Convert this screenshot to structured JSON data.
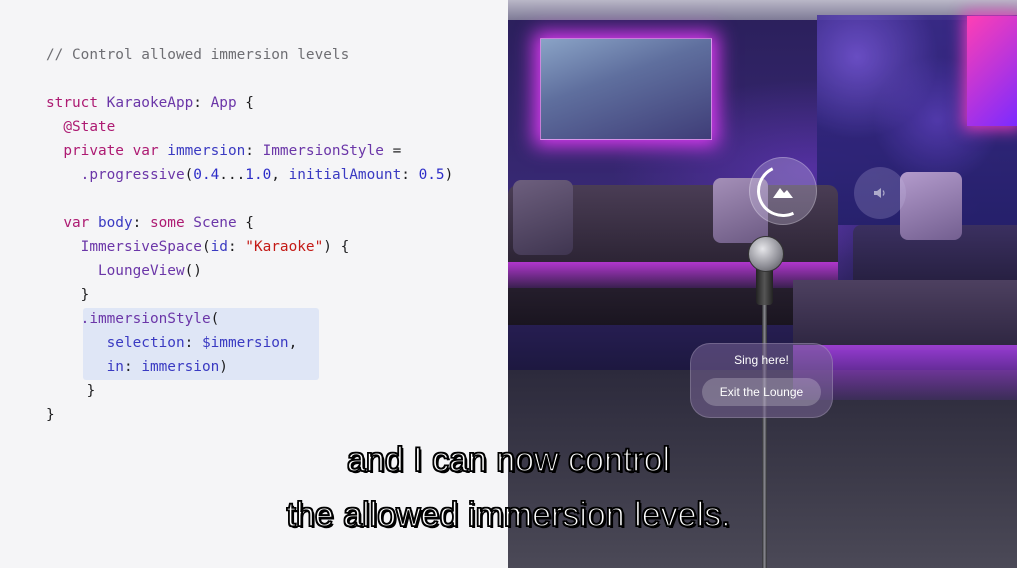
{
  "code": {
    "lines": [
      [
        {
          "t": "// Control allowed immersion levels",
          "c": "comment"
        }
      ],
      [
        {
          "t": "struct ",
          "c": "kw"
        },
        {
          "t": "KaraokeApp",
          "c": "type"
        },
        {
          "t": ": ",
          "c": "plain"
        },
        {
          "t": "App",
          "c": "type"
        },
        {
          "t": " {",
          "c": "plain"
        }
      ],
      [
        {
          "t": "  @State",
          "c": "kw"
        }
      ],
      [
        {
          "t": "  private var ",
          "c": "kw"
        },
        {
          "t": "immersion",
          "c": "prop"
        },
        {
          "t": ": ",
          "c": "plain"
        },
        {
          "t": "ImmersionStyle",
          "c": "type"
        },
        {
          "t": " =",
          "c": "plain"
        }
      ],
      [
        {
          "t": "    .progressive",
          "c": "type"
        },
        {
          "t": "(",
          "c": "plain"
        },
        {
          "t": "0.4",
          "c": "num"
        },
        {
          "t": "...",
          "c": "plain"
        },
        {
          "t": "1.0",
          "c": "num"
        },
        {
          "t": ", ",
          "c": "plain"
        },
        {
          "t": "initialAmount",
          "c": "prop"
        },
        {
          "t": ": ",
          "c": "plain"
        },
        {
          "t": "0.5",
          "c": "num"
        },
        {
          "t": ")",
          "c": "plain"
        }
      ],
      [
        {
          "t": "  var ",
          "c": "kw"
        },
        {
          "t": "body",
          "c": "prop"
        },
        {
          "t": ": ",
          "c": "plain"
        },
        {
          "t": "some ",
          "c": "kw"
        },
        {
          "t": "Scene",
          "c": "type"
        },
        {
          "t": " {",
          "c": "plain"
        }
      ],
      [
        {
          "t": "    ImmersiveSpace",
          "c": "type"
        },
        {
          "t": "(",
          "c": "plain"
        },
        {
          "t": "id",
          "c": "prop"
        },
        {
          "t": ": ",
          "c": "plain"
        },
        {
          "t": "\"Karaoke\"",
          "c": "str"
        },
        {
          "t": ") {",
          "c": "plain"
        }
      ],
      [
        {
          "t": "      LoungeView",
          "c": "type"
        },
        {
          "t": "()",
          "c": "plain"
        }
      ],
      [
        {
          "t": "    }",
          "c": "plain"
        }
      ],
      [
        {
          "t": "    .immersionStyle",
          "c": "type"
        },
        {
          "t": "(",
          "c": "plain"
        }
      ],
      [
        {
          "t": "       selection",
          "c": "prop"
        },
        {
          "t": ": ",
          "c": "plain"
        },
        {
          "t": "$immersion",
          "c": "prop"
        },
        {
          "t": ",",
          "c": "plain"
        }
      ],
      [
        {
          "t": "       in",
          "c": "prop"
        },
        {
          "t": ": ",
          "c": "plain"
        },
        {
          "t": "immersion",
          "c": "prop"
        },
        {
          "t": ")",
          "c": "plain"
        }
      ],
      [
        {
          "t": "    }",
          "c": "plain"
        }
      ],
      [
        {
          "t": "}",
          "c": "plain"
        }
      ]
    ]
  },
  "scene": {
    "menu": {
      "title": "Sing here!",
      "exit_label": "Exit the Lounge"
    },
    "ornaments": {
      "immersion_icon": "mountain-icon",
      "volume_icon": "speaker-icon",
      "immersion_level": 0.5
    }
  },
  "captions": {
    "line1": "and I can now control",
    "line2": "the allowed immersion levels."
  }
}
